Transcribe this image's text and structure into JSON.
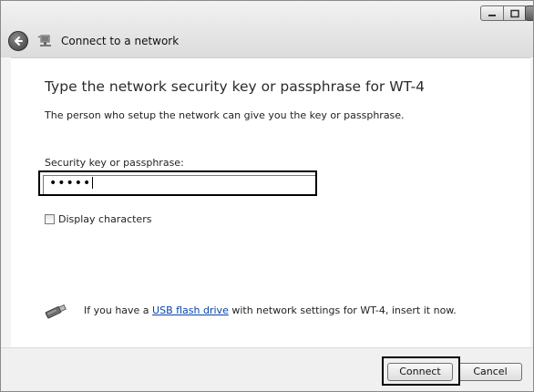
{
  "window": {
    "title": "Connect to a network",
    "controls": {
      "minimize": "minimize-icon",
      "maximize": "maximize-icon",
      "close": "close-icon"
    }
  },
  "main": {
    "heading": "Type the network security key or passphrase for WT-4",
    "description": "The person who setup the network can give you the key or passphrase.",
    "field_label": "Security key or passphrase:",
    "key_value": "•••••",
    "checkbox_label": "Display characters",
    "checkbox_checked": false,
    "usb_prefix": "If you have a ",
    "usb_link": "USB flash drive",
    "usb_suffix": " with network settings for WT-4, insert it now."
  },
  "footer": {
    "connect_label": "Connect",
    "cancel_label": "Cancel"
  },
  "colors": {
    "link": "#0645ad",
    "highlight": "#000000"
  }
}
